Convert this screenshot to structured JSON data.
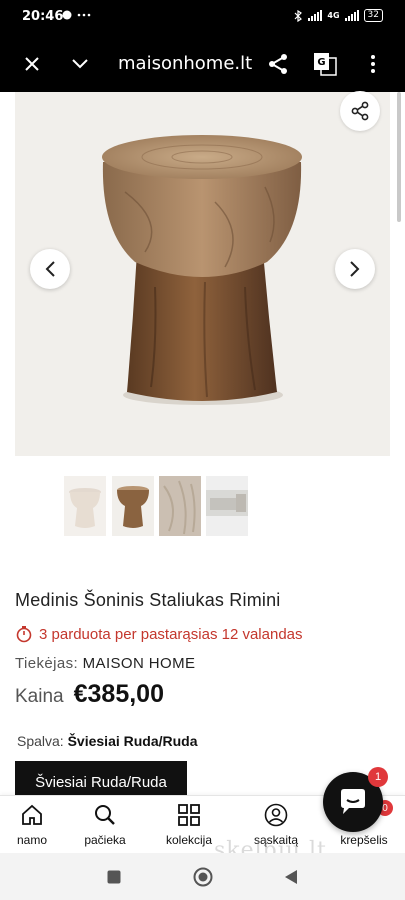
{
  "status_bar": {
    "time": "20:46",
    "notif_icons": "♥ ···",
    "network": "4G",
    "battery": "32"
  },
  "browser": {
    "url": "maisonhome.lt"
  },
  "product": {
    "title": "Medinis Šoninis Staliukas Rimini",
    "sold_text": "3 parduota per pastarąsias 12 valandas",
    "supplier_label": "Tiekėjas:",
    "supplier_value": "MAISON HOME",
    "price_label": "Kaina",
    "price_value": "€385,00",
    "color_label": "Spalva:",
    "color_value": "Šviesiai Ruda/Ruda",
    "variant_button": "Šviesiai Ruda/Ruda"
  },
  "thumbnails": [
    {
      "name": "thumb-light-stool"
    },
    {
      "name": "thumb-dark-stool"
    },
    {
      "name": "thumb-texture"
    },
    {
      "name": "thumb-room"
    }
  ],
  "bottom_nav": [
    {
      "label": "namo",
      "icon": "home-icon"
    },
    {
      "label": "pačieka",
      "icon": "search-icon"
    },
    {
      "label": "kolekcija",
      "icon": "grid-icon"
    },
    {
      "label": "sąskaitą",
      "icon": "user-icon"
    },
    {
      "label": "krepšelis",
      "icon": "cart-icon"
    }
  ],
  "chat_badge": "1",
  "cart_badge": "0",
  "watermark": "skelbiu.lt",
  "colors": {
    "accent": "#c4372d",
    "badge": "#e0383b",
    "dark": "#111111"
  }
}
